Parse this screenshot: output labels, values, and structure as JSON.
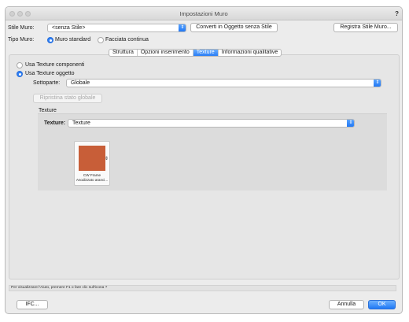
{
  "window": {
    "title": "Impostazioni Muro",
    "help": "?"
  },
  "top": {
    "stile_label": "Stile Muro:",
    "stile_value": "<senza Stile>",
    "convert_button": "Converti in Oggetto senza Stile",
    "register_button": "Registra Stile Muro...",
    "tipo_label": "Tipo Muro:",
    "radio_standard": "Muro standard",
    "radio_facciata": "Facciata continua"
  },
  "tabs": [
    "Struttura",
    "Opzioni inserimento",
    "Texture",
    "Informazioni qualitative"
  ],
  "texture_pane": {
    "use_components": "Usa Texture componenti",
    "use_object": "Usa Texture oggetto",
    "sottoparte_label": "Sottoparte:",
    "sottoparte_value": "Globale",
    "restore_button": "Ripristina stato globale",
    "group_title": "Texture",
    "texture_label": "Texture:",
    "texture_value": "Texture",
    "tile_caption_1": "CW Frame",
    "tile_caption_2": "Anodizzato aranci..."
  },
  "status": {
    "text": "Per visualizzare l'Aiuto, premere F1 o fare clic sull'icona ?"
  },
  "footer": {
    "ifc_button": "IFC...",
    "cancel_button": "Annulla",
    "ok_button": "OK"
  },
  "colors": {
    "accent": "#2f80f7",
    "swatch": "#c85e38"
  }
}
